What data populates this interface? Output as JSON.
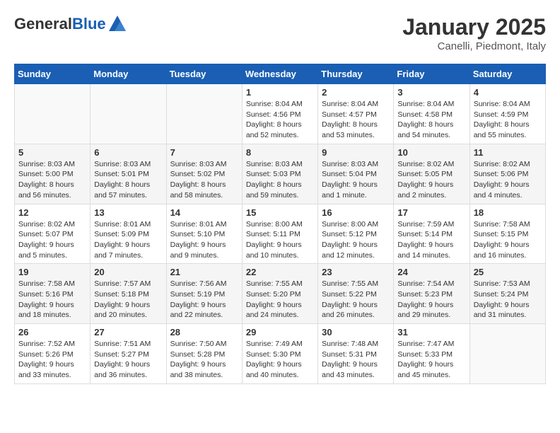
{
  "header": {
    "logo_general": "General",
    "logo_blue": "Blue",
    "month_title": "January 2025",
    "subtitle": "Canelli, Piedmont, Italy"
  },
  "weekdays": [
    "Sunday",
    "Monday",
    "Tuesday",
    "Wednesday",
    "Thursday",
    "Friday",
    "Saturday"
  ],
  "weeks": [
    [
      {
        "day": "",
        "info": ""
      },
      {
        "day": "",
        "info": ""
      },
      {
        "day": "",
        "info": ""
      },
      {
        "day": "1",
        "info": "Sunrise: 8:04 AM\nSunset: 4:56 PM\nDaylight: 8 hours\nand 52 minutes."
      },
      {
        "day": "2",
        "info": "Sunrise: 8:04 AM\nSunset: 4:57 PM\nDaylight: 8 hours\nand 53 minutes."
      },
      {
        "day": "3",
        "info": "Sunrise: 8:04 AM\nSunset: 4:58 PM\nDaylight: 8 hours\nand 54 minutes."
      },
      {
        "day": "4",
        "info": "Sunrise: 8:04 AM\nSunset: 4:59 PM\nDaylight: 8 hours\nand 55 minutes."
      }
    ],
    [
      {
        "day": "5",
        "info": "Sunrise: 8:03 AM\nSunset: 5:00 PM\nDaylight: 8 hours\nand 56 minutes."
      },
      {
        "day": "6",
        "info": "Sunrise: 8:03 AM\nSunset: 5:01 PM\nDaylight: 8 hours\nand 57 minutes."
      },
      {
        "day": "7",
        "info": "Sunrise: 8:03 AM\nSunset: 5:02 PM\nDaylight: 8 hours\nand 58 minutes."
      },
      {
        "day": "8",
        "info": "Sunrise: 8:03 AM\nSunset: 5:03 PM\nDaylight: 8 hours\nand 59 minutes."
      },
      {
        "day": "9",
        "info": "Sunrise: 8:03 AM\nSunset: 5:04 PM\nDaylight: 9 hours\nand 1 minute."
      },
      {
        "day": "10",
        "info": "Sunrise: 8:02 AM\nSunset: 5:05 PM\nDaylight: 9 hours\nand 2 minutes."
      },
      {
        "day": "11",
        "info": "Sunrise: 8:02 AM\nSunset: 5:06 PM\nDaylight: 9 hours\nand 4 minutes."
      }
    ],
    [
      {
        "day": "12",
        "info": "Sunrise: 8:02 AM\nSunset: 5:07 PM\nDaylight: 9 hours\nand 5 minutes."
      },
      {
        "day": "13",
        "info": "Sunrise: 8:01 AM\nSunset: 5:09 PM\nDaylight: 9 hours\nand 7 minutes."
      },
      {
        "day": "14",
        "info": "Sunrise: 8:01 AM\nSunset: 5:10 PM\nDaylight: 9 hours\nand 9 minutes."
      },
      {
        "day": "15",
        "info": "Sunrise: 8:00 AM\nSunset: 5:11 PM\nDaylight: 9 hours\nand 10 minutes."
      },
      {
        "day": "16",
        "info": "Sunrise: 8:00 AM\nSunset: 5:12 PM\nDaylight: 9 hours\nand 12 minutes."
      },
      {
        "day": "17",
        "info": "Sunrise: 7:59 AM\nSunset: 5:14 PM\nDaylight: 9 hours\nand 14 minutes."
      },
      {
        "day": "18",
        "info": "Sunrise: 7:58 AM\nSunset: 5:15 PM\nDaylight: 9 hours\nand 16 minutes."
      }
    ],
    [
      {
        "day": "19",
        "info": "Sunrise: 7:58 AM\nSunset: 5:16 PM\nDaylight: 9 hours\nand 18 minutes."
      },
      {
        "day": "20",
        "info": "Sunrise: 7:57 AM\nSunset: 5:18 PM\nDaylight: 9 hours\nand 20 minutes."
      },
      {
        "day": "21",
        "info": "Sunrise: 7:56 AM\nSunset: 5:19 PM\nDaylight: 9 hours\nand 22 minutes."
      },
      {
        "day": "22",
        "info": "Sunrise: 7:55 AM\nSunset: 5:20 PM\nDaylight: 9 hours\nand 24 minutes."
      },
      {
        "day": "23",
        "info": "Sunrise: 7:55 AM\nSunset: 5:22 PM\nDaylight: 9 hours\nand 26 minutes."
      },
      {
        "day": "24",
        "info": "Sunrise: 7:54 AM\nSunset: 5:23 PM\nDaylight: 9 hours\nand 29 minutes."
      },
      {
        "day": "25",
        "info": "Sunrise: 7:53 AM\nSunset: 5:24 PM\nDaylight: 9 hours\nand 31 minutes."
      }
    ],
    [
      {
        "day": "26",
        "info": "Sunrise: 7:52 AM\nSunset: 5:26 PM\nDaylight: 9 hours\nand 33 minutes."
      },
      {
        "day": "27",
        "info": "Sunrise: 7:51 AM\nSunset: 5:27 PM\nDaylight: 9 hours\nand 36 minutes."
      },
      {
        "day": "28",
        "info": "Sunrise: 7:50 AM\nSunset: 5:28 PM\nDaylight: 9 hours\nand 38 minutes."
      },
      {
        "day": "29",
        "info": "Sunrise: 7:49 AM\nSunset: 5:30 PM\nDaylight: 9 hours\nand 40 minutes."
      },
      {
        "day": "30",
        "info": "Sunrise: 7:48 AM\nSunset: 5:31 PM\nDaylight: 9 hours\nand 43 minutes."
      },
      {
        "day": "31",
        "info": "Sunrise: 7:47 AM\nSunset: 5:33 PM\nDaylight: 9 hours\nand 45 minutes."
      },
      {
        "day": "",
        "info": ""
      }
    ]
  ]
}
